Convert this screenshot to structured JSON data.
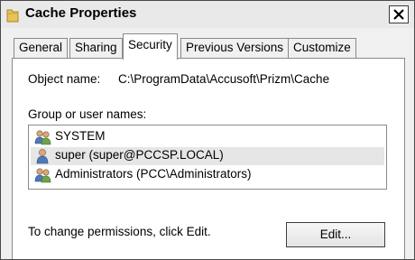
{
  "window": {
    "title": "Cache Properties",
    "icon": "folder-icon",
    "close_icon": "close-icon"
  },
  "tabs": [
    {
      "label": "General",
      "active": false
    },
    {
      "label": "Sharing",
      "active": false
    },
    {
      "label": "Security",
      "active": true
    },
    {
      "label": "Previous Versions",
      "active": false
    },
    {
      "label": "Customize",
      "active": false
    }
  ],
  "security": {
    "object_name_label": "Object name:",
    "object_name_value": "C:\\ProgramData\\Accusoft\\Prizm\\Cache",
    "group_label": "Group or user names:",
    "users": [
      {
        "name": "SYSTEM",
        "icon": "user-group-icon",
        "selected": false
      },
      {
        "name": "super (super@PCCSP.LOCAL)",
        "icon": "user-icon",
        "selected": true
      },
      {
        "name": "Administrators (PCC\\Administrators)",
        "icon": "user-group-icon",
        "selected": false
      }
    ],
    "permissions_hint": "To change permissions, click Edit.",
    "edit_button": "Edit..."
  },
  "colors": {
    "window_bg": "#f0f0f0",
    "panel_bg": "#ffffff",
    "selected_row": "#e6e6e6",
    "border": "#8a8a8a"
  }
}
